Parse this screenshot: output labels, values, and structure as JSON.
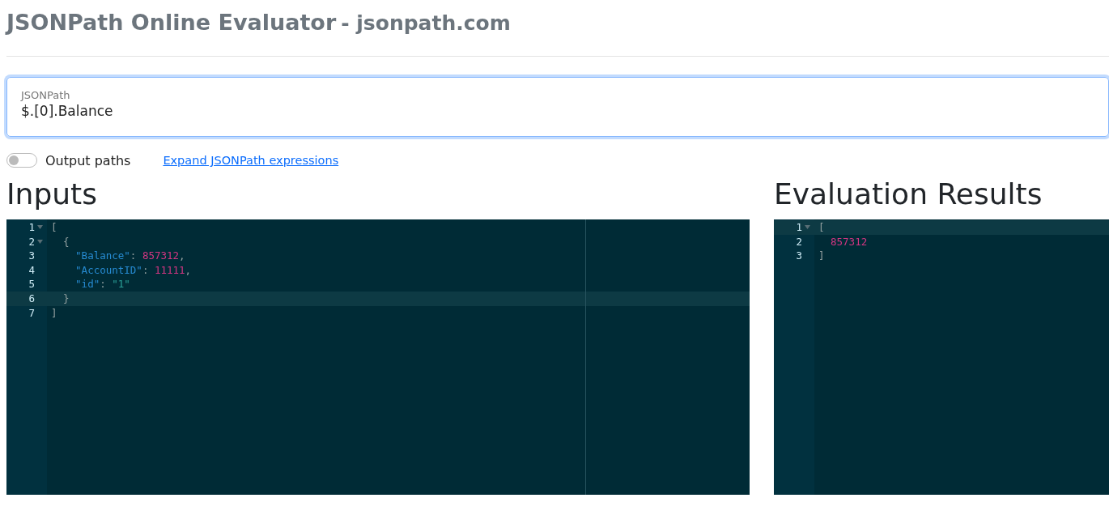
{
  "header": {
    "title": "JSONPath Online Evaluator",
    "subtitle": "- jsonpath.com"
  },
  "query": {
    "label": "JSONPath",
    "value": "$.[0].Balance",
    "focused": true
  },
  "options": {
    "output_paths": {
      "label": "Output paths",
      "on": false
    },
    "link": "Expand JSONPath expressions"
  },
  "inputs": {
    "heading": "Inputs",
    "lines": [
      {
        "number": "1",
        "foldable": true,
        "active": false,
        "tokens": [
          {
            "kind": "punct",
            "text": "["
          }
        ]
      },
      {
        "number": "2",
        "foldable": true,
        "active": false,
        "tokens": [
          {
            "kind": "punct",
            "text": "{"
          }
        ]
      },
      {
        "number": "3",
        "foldable": false,
        "active": false,
        "tokens": [
          {
            "kind": "key",
            "text": "\"Balance\""
          },
          {
            "kind": "punct",
            "text": ": "
          },
          {
            "kind": "number",
            "text": "857312"
          },
          {
            "kind": "punct",
            "text": ","
          }
        ]
      },
      {
        "number": "4",
        "foldable": false,
        "active": false,
        "tokens": [
          {
            "kind": "key",
            "text": "\"AccountID\""
          },
          {
            "kind": "punct",
            "text": ": "
          },
          {
            "kind": "number",
            "text": "11111"
          },
          {
            "kind": "punct",
            "text": ","
          }
        ]
      },
      {
        "number": "5",
        "foldable": false,
        "active": false,
        "tokens": [
          {
            "kind": "key",
            "text": "\"id\""
          },
          {
            "kind": "punct",
            "text": ": "
          },
          {
            "kind": "string",
            "text": "\"1\""
          }
        ]
      },
      {
        "number": "6",
        "foldable": false,
        "active": true,
        "tokens": [
          {
            "kind": "punct",
            "text": "}"
          }
        ]
      },
      {
        "number": "7",
        "foldable": false,
        "active": false,
        "tokens": [
          {
            "kind": "punct",
            "text": "]"
          }
        ]
      }
    ]
  },
  "results": {
    "heading": "Evaluation Results",
    "lines": [
      {
        "number": "1",
        "foldable": true,
        "active": true,
        "tokens": [
          {
            "kind": "punct",
            "text": "["
          }
        ]
      },
      {
        "number": "2",
        "foldable": false,
        "active": false,
        "tokens": [
          {
            "kind": "number",
            "text": "857312"
          }
        ]
      },
      {
        "number": "3",
        "foldable": false,
        "active": false,
        "tokens": [
          {
            "kind": "punct",
            "text": "]"
          }
        ]
      }
    ]
  }
}
